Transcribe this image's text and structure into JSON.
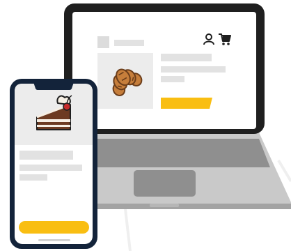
{
  "colors": {
    "background": "#ffffff",
    "outline": "#1f1f1f",
    "phone_frame": "#13233a",
    "screen_white": "#ffffff",
    "placeholder_gray": "#e2e2e2",
    "image_gray": "#ececec",
    "keyboard_gray": "#8f8f8f",
    "laptop_base": "#c9c9c9",
    "laptop_edge": "#a3a3a3",
    "accent_yellow": "#f9be12",
    "croissant": "#c67e3b",
    "croissant_dark": "#6b3d1a",
    "cake_sponge": "#6d3b22",
    "cake_cream": "#f6efe4",
    "cherry": "#c72b2b"
  },
  "laptop": {
    "header_icons": [
      "user-icon",
      "cart-icon"
    ],
    "product_image_icon": "croissant-icon"
  },
  "phone": {
    "product_image_icon": "cake-slice-icon"
  }
}
